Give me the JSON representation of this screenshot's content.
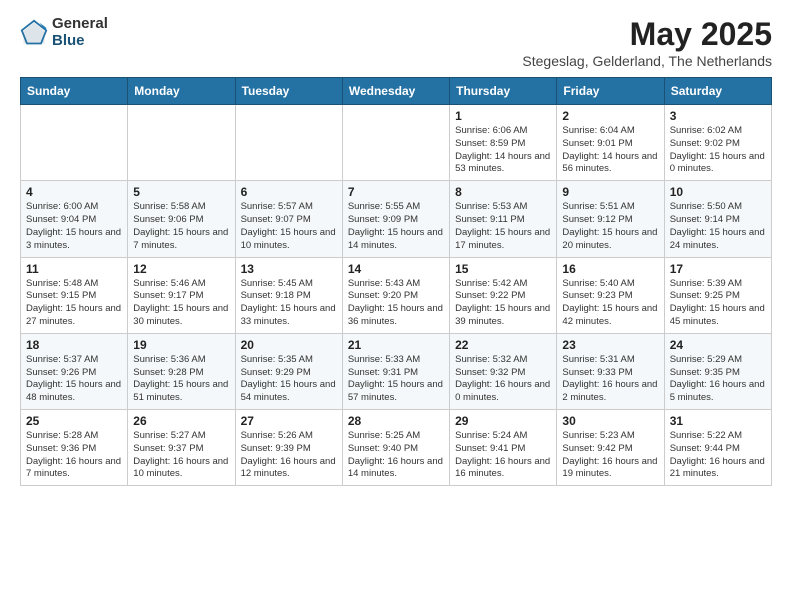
{
  "logo": {
    "general": "General",
    "blue": "Blue"
  },
  "title": "May 2025",
  "location": "Stegeslag, Gelderland, The Netherlands",
  "weekdays": [
    "Sunday",
    "Monday",
    "Tuesday",
    "Wednesday",
    "Thursday",
    "Friday",
    "Saturday"
  ],
  "weeks": [
    [
      {
        "day": "",
        "info": ""
      },
      {
        "day": "",
        "info": ""
      },
      {
        "day": "",
        "info": ""
      },
      {
        "day": "",
        "info": ""
      },
      {
        "day": "1",
        "info": "Sunrise: 6:06 AM\nSunset: 8:59 PM\nDaylight: 14 hours\nand 53 minutes."
      },
      {
        "day": "2",
        "info": "Sunrise: 6:04 AM\nSunset: 9:01 PM\nDaylight: 14 hours\nand 56 minutes."
      },
      {
        "day": "3",
        "info": "Sunrise: 6:02 AM\nSunset: 9:02 PM\nDaylight: 15 hours\nand 0 minutes."
      }
    ],
    [
      {
        "day": "4",
        "info": "Sunrise: 6:00 AM\nSunset: 9:04 PM\nDaylight: 15 hours\nand 3 minutes."
      },
      {
        "day": "5",
        "info": "Sunrise: 5:58 AM\nSunset: 9:06 PM\nDaylight: 15 hours\nand 7 minutes."
      },
      {
        "day": "6",
        "info": "Sunrise: 5:57 AM\nSunset: 9:07 PM\nDaylight: 15 hours\nand 10 minutes."
      },
      {
        "day": "7",
        "info": "Sunrise: 5:55 AM\nSunset: 9:09 PM\nDaylight: 15 hours\nand 14 minutes."
      },
      {
        "day": "8",
        "info": "Sunrise: 5:53 AM\nSunset: 9:11 PM\nDaylight: 15 hours\nand 17 minutes."
      },
      {
        "day": "9",
        "info": "Sunrise: 5:51 AM\nSunset: 9:12 PM\nDaylight: 15 hours\nand 20 minutes."
      },
      {
        "day": "10",
        "info": "Sunrise: 5:50 AM\nSunset: 9:14 PM\nDaylight: 15 hours\nand 24 minutes."
      }
    ],
    [
      {
        "day": "11",
        "info": "Sunrise: 5:48 AM\nSunset: 9:15 PM\nDaylight: 15 hours\nand 27 minutes."
      },
      {
        "day": "12",
        "info": "Sunrise: 5:46 AM\nSunset: 9:17 PM\nDaylight: 15 hours\nand 30 minutes."
      },
      {
        "day": "13",
        "info": "Sunrise: 5:45 AM\nSunset: 9:18 PM\nDaylight: 15 hours\nand 33 minutes."
      },
      {
        "day": "14",
        "info": "Sunrise: 5:43 AM\nSunset: 9:20 PM\nDaylight: 15 hours\nand 36 minutes."
      },
      {
        "day": "15",
        "info": "Sunrise: 5:42 AM\nSunset: 9:22 PM\nDaylight: 15 hours\nand 39 minutes."
      },
      {
        "day": "16",
        "info": "Sunrise: 5:40 AM\nSunset: 9:23 PM\nDaylight: 15 hours\nand 42 minutes."
      },
      {
        "day": "17",
        "info": "Sunrise: 5:39 AM\nSunset: 9:25 PM\nDaylight: 15 hours\nand 45 minutes."
      }
    ],
    [
      {
        "day": "18",
        "info": "Sunrise: 5:37 AM\nSunset: 9:26 PM\nDaylight: 15 hours\nand 48 minutes."
      },
      {
        "day": "19",
        "info": "Sunrise: 5:36 AM\nSunset: 9:28 PM\nDaylight: 15 hours\nand 51 minutes."
      },
      {
        "day": "20",
        "info": "Sunrise: 5:35 AM\nSunset: 9:29 PM\nDaylight: 15 hours\nand 54 minutes."
      },
      {
        "day": "21",
        "info": "Sunrise: 5:33 AM\nSunset: 9:31 PM\nDaylight: 15 hours\nand 57 minutes."
      },
      {
        "day": "22",
        "info": "Sunrise: 5:32 AM\nSunset: 9:32 PM\nDaylight: 16 hours\nand 0 minutes."
      },
      {
        "day": "23",
        "info": "Sunrise: 5:31 AM\nSunset: 9:33 PM\nDaylight: 16 hours\nand 2 minutes."
      },
      {
        "day": "24",
        "info": "Sunrise: 5:29 AM\nSunset: 9:35 PM\nDaylight: 16 hours\nand 5 minutes."
      }
    ],
    [
      {
        "day": "25",
        "info": "Sunrise: 5:28 AM\nSunset: 9:36 PM\nDaylight: 16 hours\nand 7 minutes."
      },
      {
        "day": "26",
        "info": "Sunrise: 5:27 AM\nSunset: 9:37 PM\nDaylight: 16 hours\nand 10 minutes."
      },
      {
        "day": "27",
        "info": "Sunrise: 5:26 AM\nSunset: 9:39 PM\nDaylight: 16 hours\nand 12 minutes."
      },
      {
        "day": "28",
        "info": "Sunrise: 5:25 AM\nSunset: 9:40 PM\nDaylight: 16 hours\nand 14 minutes."
      },
      {
        "day": "29",
        "info": "Sunrise: 5:24 AM\nSunset: 9:41 PM\nDaylight: 16 hours\nand 16 minutes."
      },
      {
        "day": "30",
        "info": "Sunrise: 5:23 AM\nSunset: 9:42 PM\nDaylight: 16 hours\nand 19 minutes."
      },
      {
        "day": "31",
        "info": "Sunrise: 5:22 AM\nSunset: 9:44 PM\nDaylight: 16 hours\nand 21 minutes."
      }
    ]
  ]
}
